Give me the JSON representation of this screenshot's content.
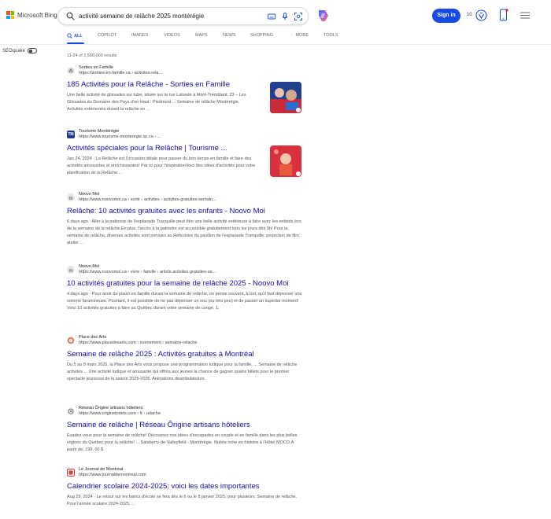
{
  "header": {
    "logo_text": "Microsoft Bing",
    "search_query": "activité semaine de relâche 2025 montérégie",
    "signin_label": "Sign in",
    "rewards_count": "10"
  },
  "tabs": [
    {
      "label": "ALL"
    },
    {
      "label": "COPILOT"
    },
    {
      "label": "IMAGES"
    },
    {
      "label": "VIDEOS"
    },
    {
      "label": "MAPS"
    },
    {
      "label": "NEWS"
    },
    {
      "label": "SHOPPING"
    },
    {
      "label": "MORE"
    },
    {
      "label": "TOOLS"
    }
  ],
  "seoquake": {
    "label": "SEOquake"
  },
  "result_count": "11-24 of 2,560,000 results",
  "results": [
    {
      "site": "Sorties en Famille",
      "url": "https://sorties-en-famille.ca › activites-rela...",
      "title": "185 Activités pour la Relâche - Sorties en Famille",
      "snippet": "Une belle activité de glissades sur tube, située sur la rue Lalonde à Mont-Tremblant. 23 – Les Glissades du Domaine des Pays d'en Haut : Piedmont ... Semaine de relâche Montérégie. Activités extérieures durant la relâche en ..."
    },
    {
      "site": "Tourisme Montérégie",
      "url": "https://www.tourisme-monteregie.qc.ca › ...",
      "title": "Activités spéciales pour la Relâche | Tourisme ...",
      "snippet": "Jan 24, 2024 · La Relâche est l'occasion idéale pour passer du bon temps en famille et faire des activités amusantes et enrichissantes! Par ici pour l'inspirationVoici des idées d'activités pour votre planification de la Relâche ..."
    },
    {
      "site": "Noovo Moi",
      "url": "https://www.noovomoi.ca › sortir › activites › activites-gratuites-semain...",
      "title": "Relâche: 10 activités gratuites avec les enfants - Noovo Moi",
      "snippet": "6 days ago · Aller à la patinoire de l'esplanade Tranquille peut être une belle activité extérieure à faire avec les enfants lors de la semaine de la relâche.En plus, l'accès à la patinoire est accessible gratuitement tous les jours dès 9h! Pour la semaine de relâche, diverses activités sont prévues au Réfectoire du pavillon de l'esplanade Tranquille: projection de film, atelier ..."
    },
    {
      "site": "Noovo Moi",
      "url": "https://www.noovomoi.ca › vivre › famille › article.activites-gratuites-se...",
      "title": "10 activités gratuites pour la semaine de relâche 2025 - Noovo Moi",
      "snippet": "4 days ago · Pour avoir du plaisir en famille durant la semaine de relâche, on pense souvent, à tort, qu'il faut dépenser une somme faramineuse. Pourtant, il est possible de ne pas dépenser un sou (ou très peu) et de passer un superbe moment! Voici 10 activités gratuites à faire au Québec durant votre semaine de congé. 1."
    },
    {
      "site": "Place des Arts",
      "url": "https://www.placedesarts.com › evenement › semaine-relache",
      "title": "Semaine de relâche 2025 : Activités gratuites à Montréal",
      "snippet": "Du 5 au 8 mars 2025, la Place des Arts vous propose une programmation ludique pour la famille. ... Semaine de relâche activités ... Une activité ludique et amusante qui offrira aux jeunes la chance de gagner quatre billets pour le premier spectacle jeunesse de la saison 2025-2026. Animations déambulatoires."
    },
    {
      "site": "Réseau Ôrigine artisans hôteliers",
      "url": "https://www.originehotels.com › fr › relache",
      "title": "Semaine de relâche | Réseau Ôrigine artisans hôteliers",
      "snippet": "Évadez-vous pour la semaine de relâche! Découvrez nos idées d'escapades en couple et en famille dans les plus belles régions du Québec pour la relâche! ... Salaberry-de-Valleyfield - Montérégie. Nuitée riche en histoire à l'Hôtel MOCO À partir de. 199, 00 $"
    },
    {
      "site": "Le Journal de Montréal",
      "url": "https://www.journaldemontreal.com",
      "title": "Calendrier scolaire 2024-2025: voici les dates importantes",
      "snippet": "Aug 29, 2024 · Le retour sur les bancs d'école se fera dès le 6 ou le 8 janvier 2025, pour plusieurs. Semaine de relâche. Pour l'année scolaire 2024-2025, ..."
    }
  ]
}
